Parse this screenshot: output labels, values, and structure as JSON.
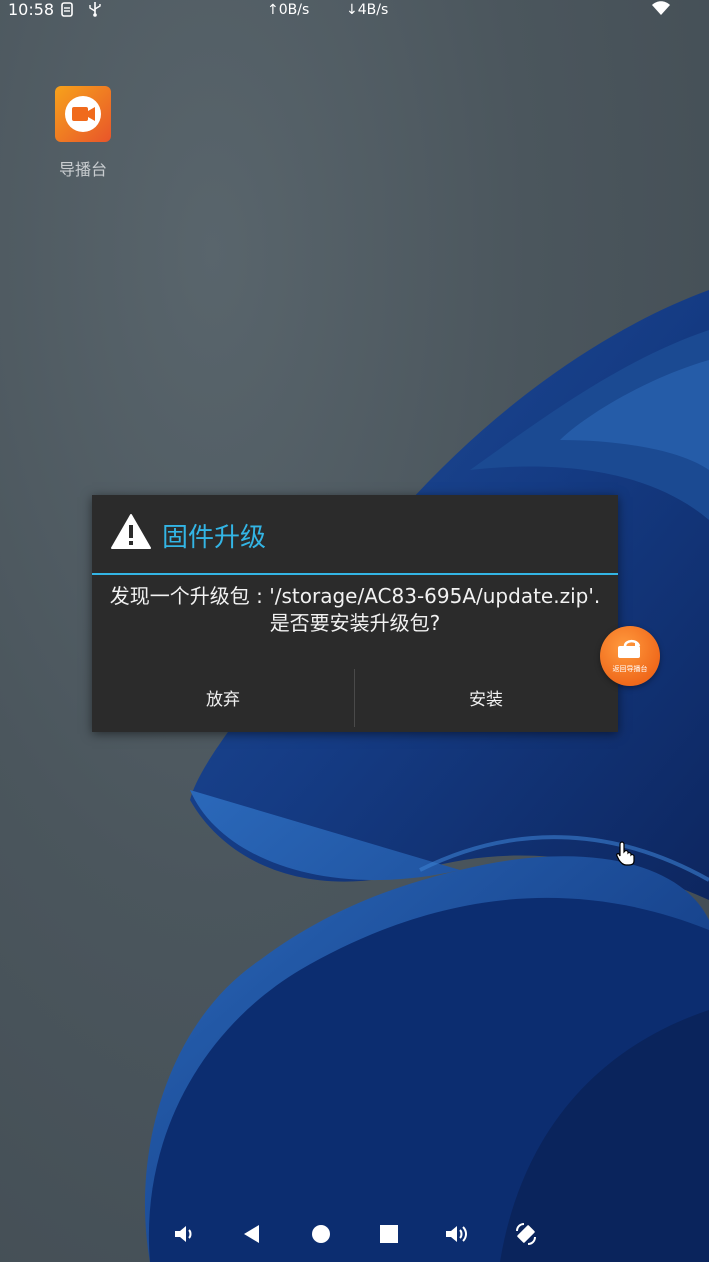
{
  "status_bar": {
    "time": "10:58",
    "upload_rate": "↑0B/s",
    "download_rate": "↓4B/s",
    "icons": [
      "sim-icon",
      "usb-icon",
      "wifi-icon"
    ]
  },
  "desktop": {
    "apps": [
      {
        "label": "导播台",
        "icon": "video-camera-icon"
      }
    ]
  },
  "dialog": {
    "title": "固件升级",
    "icon": "warning-icon",
    "message_line1": "发现一个升级包 : '/storage/AC83-695A/update.zip'.",
    "message_line2": "是否要安装升级包?",
    "cancel_label": "放弃",
    "confirm_label": "安装",
    "accent_color": "#33b5e5"
  },
  "floating_button": {
    "label": "返回导播台",
    "color": "#f06a1c"
  },
  "nav_bar": {
    "buttons": [
      "volume-down-icon",
      "back-icon",
      "home-icon",
      "recents-icon",
      "volume-up-icon",
      "rotate-icon"
    ]
  }
}
